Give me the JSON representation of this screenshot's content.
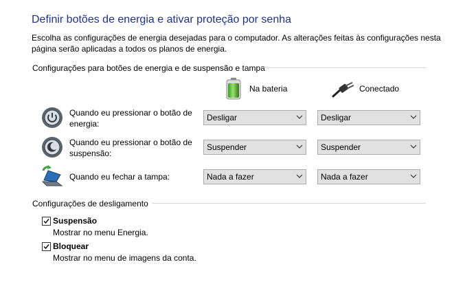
{
  "page": {
    "title": "Definir botões de energia e ativar proteção por senha",
    "description": "Escolha as configurações de energia desejadas para o computador. As alterações feitas às configurações nesta página serão aplicadas a todos os planos de energia."
  },
  "power_buttons": {
    "group_label": "Configurações para botões de energia e de suspensão e tampa",
    "columns": {
      "battery": "Na bateria",
      "plugged": "Conectado"
    },
    "rows": [
      {
        "label": "Quando eu pressionar o botão de energia:",
        "battery_value": "Desligar",
        "plugged_value": "Desligar",
        "icon": "power-button-icon"
      },
      {
        "label": "Quando eu pressionar o botão de suspensão:",
        "battery_value": "Suspender",
        "plugged_value": "Suspender",
        "icon": "sleep-button-icon"
      },
      {
        "label": "Quando eu fechar a tampa:",
        "battery_value": "Nada a fazer",
        "plugged_value": "Nada a fazer",
        "icon": "laptop-lid-icon"
      }
    ]
  },
  "shutdown": {
    "group_label": "Configurações de desligamento",
    "options": [
      {
        "label": "Suspensão",
        "description": "Mostrar no menu Energia.",
        "checked": true
      },
      {
        "label": "Bloquear",
        "description": "Mostrar no menu de imagens da conta.",
        "checked": true
      }
    ]
  },
  "colors": {
    "title": "#1e3287",
    "dropdown_bg": "#e1e1e1",
    "rule": "#d7d7d7"
  }
}
